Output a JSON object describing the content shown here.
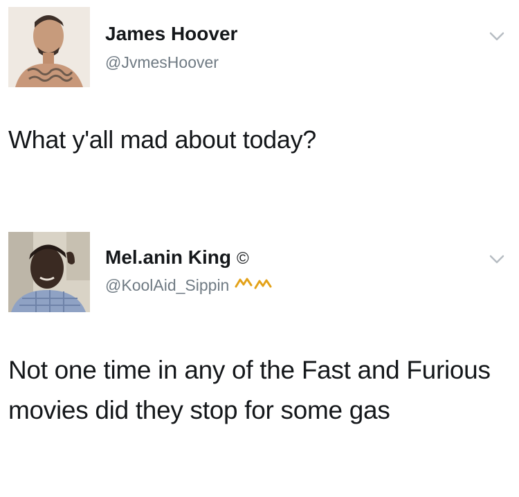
{
  "tweets": [
    {
      "display_name": "James Hoover",
      "handle": "@JvmesHoover",
      "text": "What y'all mad about today?",
      "avatar_icon": "profile-photo",
      "menu_icon": "chevron-down-icon"
    },
    {
      "display_name": "Mel.anin King",
      "name_badge": "©",
      "handle": "@KoolAid_Sippin",
      "handle_marks_icon": "crown-marks-icon",
      "text": "Not one time in any of the Fast and Furious movies did they stop for some gas",
      "avatar_icon": "profile-photo",
      "menu_icon": "chevron-down-icon"
    }
  ],
  "colors": {
    "text": "#14171a",
    "handle": "#6f7a83",
    "chevron": "#b6bcc2",
    "crown_marks": "#e3a21a"
  }
}
